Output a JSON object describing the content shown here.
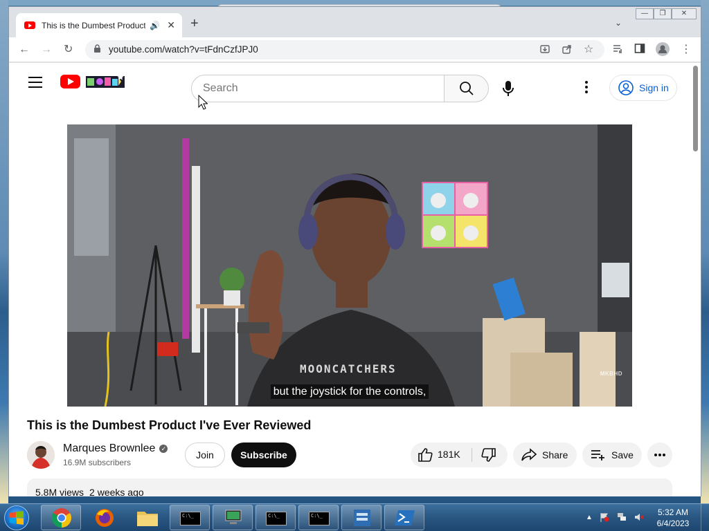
{
  "browser": {
    "tab_title": "This is the Dumbest Product I've Ever Reviewed",
    "url": "youtube.com/watch?v=tFdnCzfJPJ0"
  },
  "youtube": {
    "search_placeholder": "Search",
    "sign_in": "Sign in"
  },
  "video": {
    "caption": "but the joystick for the controls,",
    "watermark": "MKBHD",
    "shirt_text": "MOONCATCHERS",
    "title": "This is the Dumbest Product I've Ever Reviewed",
    "channel_name": "Marques Brownlee",
    "subscribers": "16.9M subscribers",
    "join_label": "Join",
    "subscribe_label": "Subscribe",
    "likes": "181K",
    "share_label": "Share",
    "save_label": "Save",
    "views": "5.8M views",
    "published": "2 weeks ago"
  },
  "taskbar": {
    "time": "5:32 AM",
    "date": "6/4/2023"
  },
  "colors": {
    "youtube_red": "#ff0000",
    "link_blue": "#065fd4",
    "subscribe_bg": "#0f0f0f"
  }
}
